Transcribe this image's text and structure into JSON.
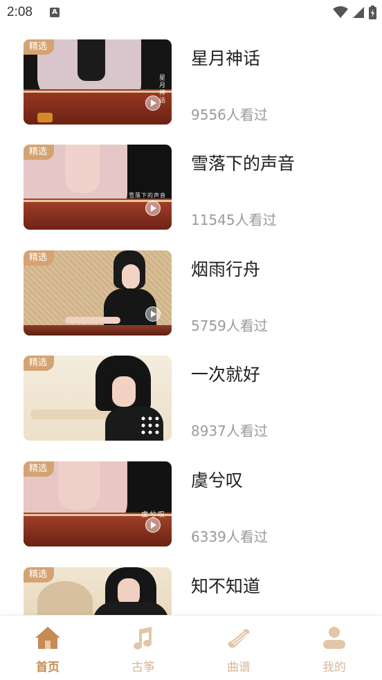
{
  "status_bar": {
    "time": "2:08",
    "icons": [
      "text-a-icon",
      "wifi-icon",
      "signal-icon",
      "battery-charging-icon"
    ]
  },
  "feed": {
    "badge_label": "精选",
    "items": [
      {
        "title": "星月神话",
        "views": "9556人看过",
        "thumb_caption": "星月神话"
      },
      {
        "title": "雪落下的声音",
        "views": "11545人看过",
        "thumb_caption": "雪落下的声音"
      },
      {
        "title": "烟雨行舟",
        "views": "5759人看过",
        "thumb_caption": ""
      },
      {
        "title": "一次就好",
        "views": "8937人看过",
        "thumb_caption": ""
      },
      {
        "title": "虞兮叹",
        "views": "6339人看过",
        "thumb_caption": "虞兮叹"
      },
      {
        "title": "知不知道",
        "views": "",
        "thumb_caption": ""
      }
    ]
  },
  "tabbar": {
    "tabs": [
      {
        "label": "首页",
        "icon": "home-icon",
        "active": true
      },
      {
        "label": "古筝",
        "icon": "music-note-icon",
        "active": false
      },
      {
        "label": "曲谱",
        "icon": "guzheng-icon",
        "active": false
      },
      {
        "label": "我的",
        "icon": "person-icon",
        "active": false
      }
    ]
  },
  "colors": {
    "accent": "#c58b53",
    "badge": "#d4a372",
    "inactive_tab": "#d9b694",
    "views_text": "#9a9a9a"
  }
}
